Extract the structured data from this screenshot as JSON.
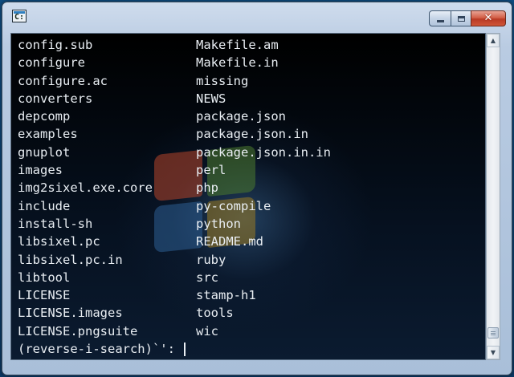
{
  "window": {
    "icon": "console-app-icon",
    "icon_glyph": "C:",
    "controls": {
      "minimize": "minimize-icon",
      "maximize": "maximize-icon",
      "close_glyph": "✕"
    }
  },
  "terminal": {
    "rows": [
      {
        "left": "config.sub",
        "right": "Makefile.am"
      },
      {
        "left": "configure",
        "right": "Makefile.in"
      },
      {
        "left": "configure.ac",
        "right": "missing"
      },
      {
        "left": "converters",
        "right": "NEWS"
      },
      {
        "left": "depcomp",
        "right": "package.json"
      },
      {
        "left": "examples",
        "right": "package.json.in"
      },
      {
        "left": "gnuplot",
        "right": "package.json.in.in"
      },
      {
        "left": "images",
        "right": "perl"
      },
      {
        "left": "img2sixel.exe.core",
        "right": "php"
      },
      {
        "left": "include",
        "right": "py-compile"
      },
      {
        "left": "install-sh",
        "right": "python"
      },
      {
        "left": "libsixel.pc",
        "right": "README.md"
      },
      {
        "left": "libsixel.pc.in",
        "right": "ruby"
      },
      {
        "left": "libtool",
        "right": "src"
      },
      {
        "left": "LICENSE",
        "right": "stamp-h1"
      },
      {
        "left": "LICENSE.images",
        "right": "tools"
      },
      {
        "left": "LICENSE.pngsuite",
        "right": "wic"
      }
    ],
    "prompt": "(reverse-i-search)`': "
  },
  "scrollbar": {
    "position": 0.97
  },
  "colors": {
    "text": "#e9eef3",
    "console_bg": "#000000",
    "close_button": "#c7442b"
  }
}
